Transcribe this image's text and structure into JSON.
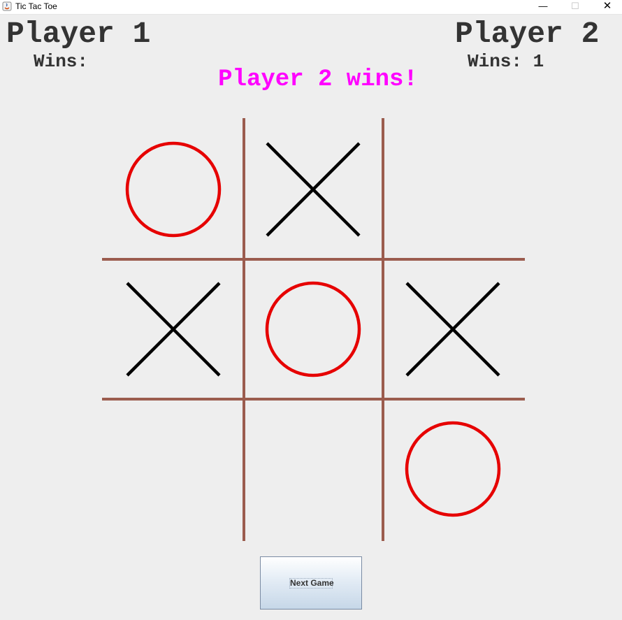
{
  "window": {
    "title": "Tic Tac Toe",
    "controls": {
      "minimize": "—",
      "maximize": "☐",
      "close": "✕"
    }
  },
  "players": [
    {
      "name": "Player 1",
      "wins_label": "Wins:"
    },
    {
      "name": "Player 2",
      "wins_label": "Wins: 1"
    }
  ],
  "status": {
    "text": "Player 2 wins!",
    "color": "#ff00ff"
  },
  "board": {
    "cells": [
      "O",
      "X",
      "",
      "X",
      "O",
      "X",
      "",
      "",
      "O"
    ],
    "colors": {
      "grid": "#9b5c4e",
      "x_mark": "#000000",
      "o_mark": "#e60000"
    }
  },
  "next_button": {
    "label": "Next Game"
  }
}
